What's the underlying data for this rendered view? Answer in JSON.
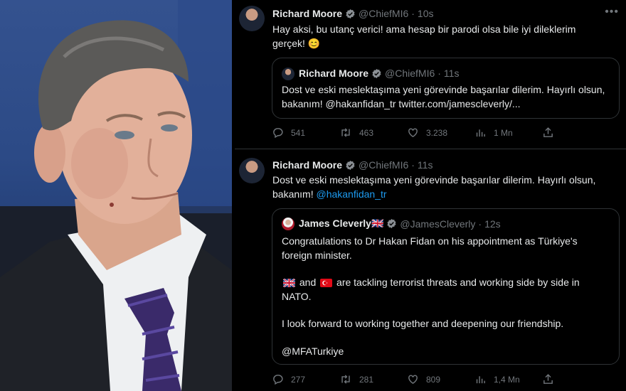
{
  "tweet1": {
    "name": "Richard Moore",
    "handle": "@ChiefMI6",
    "dot": "·",
    "time": "10s",
    "text": "Hay aksi, bu utanç verici! ama hesap bir parodi olsa bile iyi dileklerim gerçek! 😊",
    "quote": {
      "name": "Richard Moore",
      "handle": "@ChiefMI6",
      "dot": "·",
      "time": "11s",
      "text_plain": "Dost ve eski meslektaşıma yeni görevinde başarılar dilerim.  Hayırlı olsun, bakanım! @hakanfidan_tr twitter.com/jamescleverly/..."
    },
    "stats": {
      "replies": "541",
      "retweets": "463",
      "likes": "3.238",
      "views": "1 Mn"
    }
  },
  "tweet2": {
    "name": "Richard Moore",
    "handle": "@ChiefMI6",
    "dot": "·",
    "time": "11s",
    "text_plain": "Dost ve eski meslektaşıma yeni görevinde başarılar dilerim.  Hayırlı olsun, bakanım!",
    "mention": "@hakanfidan_tr",
    "quote": {
      "name": "James Cleverly🇬🇧",
      "handle": "@JamesCleverly",
      "dot": "·",
      "time": "12s",
      "para1": "Congratulations to Dr Hakan Fidan on his appointment as Türkiye's foreign minister.",
      "para2_and": "and",
      "para2_rest": "are tackling terrorist threats and working side by side in NATO.",
      "para3": "I look forward to working together and deepening our friendship.",
      "para4": "@MFATurkiye"
    },
    "stats": {
      "replies": "277",
      "retweets": "281",
      "likes": "809",
      "views": "1,4 Mn"
    }
  },
  "colors": {
    "accent": "#1d9bf0",
    "muted": "#71767b",
    "border": "#2f3336",
    "background": "#000000"
  },
  "icons": [
    "more-icon",
    "verified-badge-icon",
    "reply-icon",
    "retweet-icon",
    "like-icon",
    "views-icon",
    "share-icon",
    "uk-flag-icon",
    "turkey-flag-icon"
  ]
}
